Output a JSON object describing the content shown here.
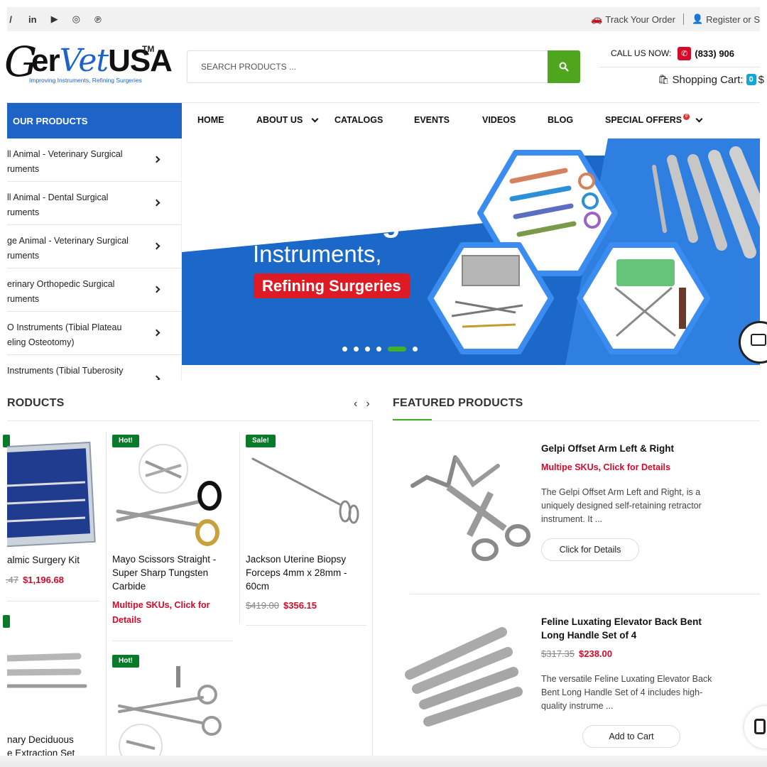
{
  "topbar": {
    "social_icons": [
      "twitter-icon",
      "linkedin-icon",
      "youtube-icon",
      "instagram-icon",
      "pinterest-icon"
    ],
    "social_glyphs": [
      "/",
      "in",
      "▶",
      "◎",
      "℗"
    ],
    "track_order": "Track Your Order",
    "register": "Register or S"
  },
  "header": {
    "logo_text_a": "G",
    "logo_text_b": "er",
    "logo_text_vet": "Vet",
    "logo_text_usa": "USA",
    "logo_tm": "TM",
    "logo_tagline": "Improving Instruments, Refining Surgeries",
    "search_placeholder": "SEARCH PRODUCTS ...",
    "call_label": "CALL US NOW:",
    "phone": "(833) 906",
    "cart_label": "Shopping Cart:",
    "cart_count": "0",
    "cart_tail": "$"
  },
  "nav": {
    "products_heading": "OUR PRODUCTS",
    "items": [
      "HOME",
      "ABOUT US",
      "CATALOGS",
      "EVENTS",
      "VIDEOS",
      "BLOG",
      "SPECIAL OFFERS"
    ],
    "special_badge": "0"
  },
  "sidebar": {
    "categories": [
      "ll Animal - Veterinary Surgical\nruments",
      "ll Animal - Dental Surgical\nruments",
      "ge Animal - Veterinary Surgical\nruments",
      "erinary Orthopedic Surgical\nruments",
      "O Instruments (Tibial Plateau\neling Osteotomy)",
      "Instruments (Tibial Tuberosity\n"
    ]
  },
  "hero": {
    "line1": "Improving",
    "line2": "Instruments,",
    "line3": "Refining Surgeries",
    "slides": 6,
    "active_slide": 4
  },
  "products": {
    "title": "RODUCTS",
    "items": [
      {
        "name": "almic Surgery Kit",
        "old_price": ".47",
        "new_price": "$1,196.68"
      },
      {
        "tag": "Hot!",
        "name": "Mayo Scissors Straight -\nSuper Sharp Tungsten\nCarbide",
        "link": "Multipe SKUs, Click for\nDetails"
      },
      {
        "tag": "Sale!",
        "name": "Jackson Uterine Biopsy\nForceps 4mm x 28mm -\n60cm",
        "old_price": "$419.00",
        "new_price": "$356.15"
      },
      {
        "name": "nary Deciduous\ne Extraction Set"
      },
      {
        "tag": "Hot!"
      }
    ]
  },
  "featured": {
    "title": "FEATURED PRODUCTS",
    "items": [
      {
        "name": "Gelpi Offset Arm Left & Right",
        "link": "Multipe SKUs, Click for Details",
        "desc": "The Gelpi Offset Arm Left and Right, is a\nuniquely designed self-retaining retractor\ninstrument. It ...",
        "button": "Click for Details"
      },
      {
        "name": "Feline Luxating Elevator Back Bent\nLong Handle Set of 4",
        "old_price": "$317.35",
        "new_price": "$238.00",
        "desc": "The versatile Feline Luxating Elevator Back\nBent Long Handle Set of 4 includes high-\nquality instrume ...",
        "button": "Add to Cart"
      }
    ]
  },
  "colors": {
    "brand_blue": "#1d64c6",
    "search_green": "#4ea51e",
    "accent_red": "#d40b2a",
    "tag_green": "#087a2a"
  }
}
